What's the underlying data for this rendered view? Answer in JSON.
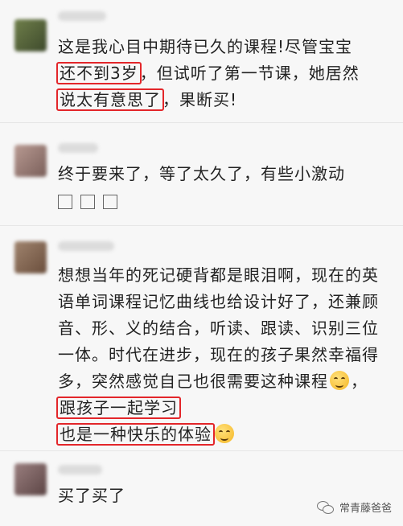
{
  "comments": [
    {
      "line1": "这是我心目中期待已久的课程!尽管宝宝",
      "hl_a": "还不到3岁",
      "mid_a": "，但试听了第一节课，她居然",
      "hl_b": "说太有意思了",
      "end_a": "，果断买!"
    },
    {
      "text": "终于要来了，等了太久了，有些小激动"
    },
    {
      "text_a": "想想当年的死记硬背都是眼泪啊，现在的英语单词课程记忆曲线也给设计好了，还兼顾音、形、义的结合，听读、跟读、识别三位一体。时代在进步，现在的孩子果然幸福得多，突然感觉自己也很需要这种课程",
      "sep": "，",
      "hl_a": "跟孩子一起学习",
      "hl_b": "也是一种快乐的体验"
    },
    {
      "text": "买了买了"
    }
  ],
  "watermark": "常青藤爸爸",
  "colors": {
    "highlight": "#e3262a",
    "background": "#f7f7f7"
  }
}
